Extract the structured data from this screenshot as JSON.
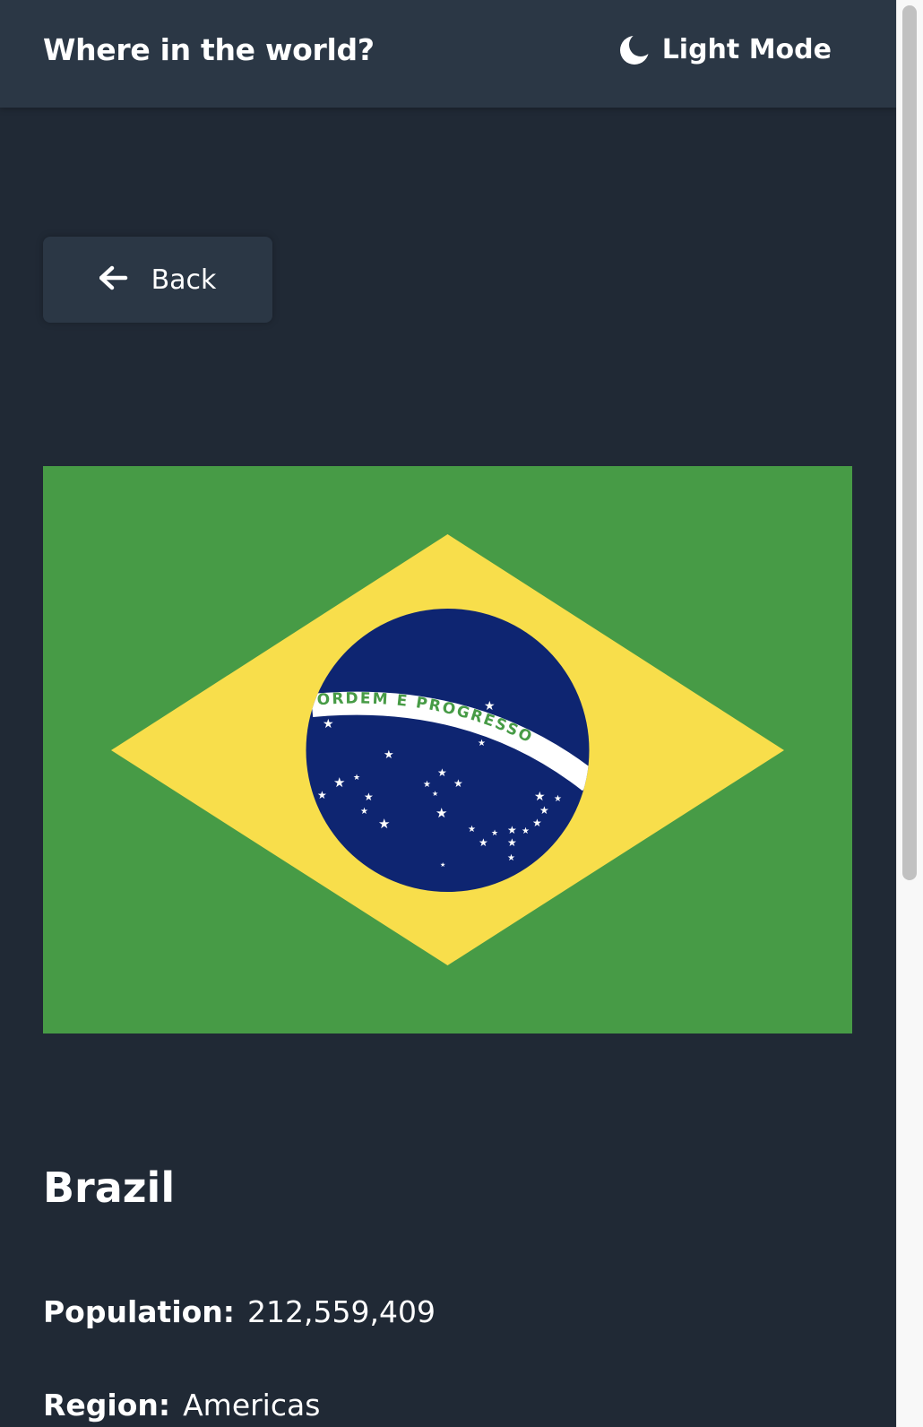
{
  "header": {
    "title": "Where in the world?",
    "theme_toggle_label": "Light Mode",
    "theme_icon": "moon-icon"
  },
  "back_button": {
    "label": "Back",
    "icon": "arrow-left-icon"
  },
  "country": {
    "name": "Brazil",
    "flag_icon": "brazil-flag",
    "flag_motto": "ORDEM E PROGRESSO",
    "details": [
      {
        "label": "Population:",
        "value": "212,559,409"
      },
      {
        "label": "Region:",
        "value": "Americas"
      }
    ]
  },
  "colors": {
    "background": "#202935",
    "surface": "#2b3745",
    "text": "#ffffff",
    "flag_green": "#479b46",
    "flag_yellow": "#f8de4b",
    "flag_blue": "#0e2571"
  }
}
